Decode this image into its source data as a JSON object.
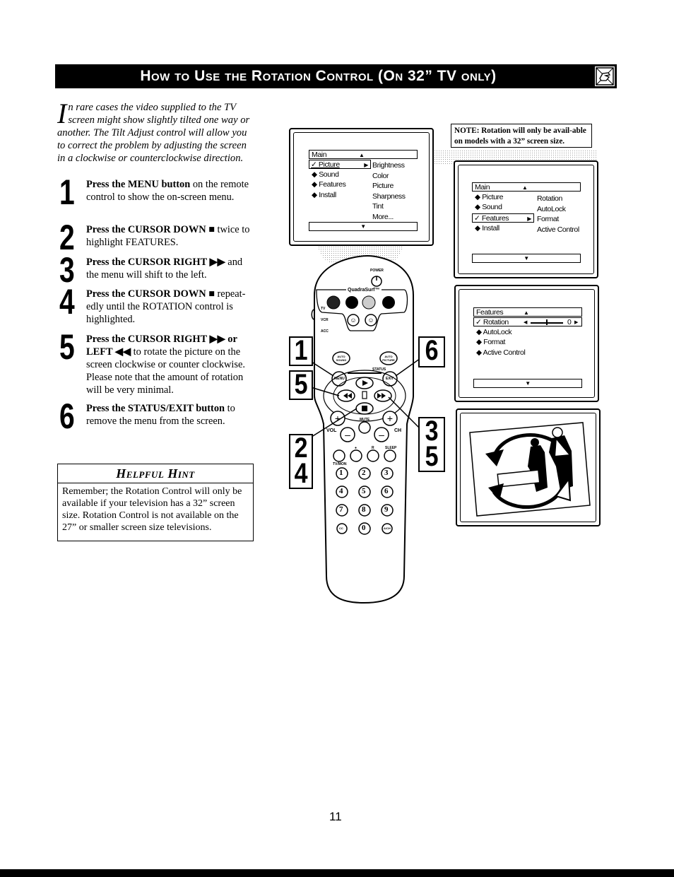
{
  "header": {
    "title": "How to Use the Rotation Control (On 32” TV only)",
    "icon": "remote-hand-icon"
  },
  "intro": {
    "dropcap": "I",
    "text": "n rare cases the video supplied to the TV screen might show slightly tilted one way or another. The Tilt Adjust control will allow you to correct the problem by adjusting the screen in a clockwise or counterclockwise direction."
  },
  "steps": [
    {
      "num": "1",
      "bold": "Press the MENU button",
      "rest": " on the remote control to show the on-screen menu."
    },
    {
      "num": "2",
      "bold": "Press the CURSOR DOWN ■",
      "rest": " twice to highlight FEATURES."
    },
    {
      "num": "3",
      "bold": "Press the CURSOR RIGHT ▶▶",
      "rest": " and the menu will shift to the left."
    },
    {
      "num": "4",
      "bold": "Press the CURSOR DOWN ■",
      "rest": " repeat-edly until the ROTATION control is highlighted."
    },
    {
      "num": "5",
      "bold": "Press the CURSOR RIGHT ▶▶ or LEFT ◀◀",
      "rest": " to rotate the picture on the screen clockwise or counter clockwise. Please note that the amount of rotation will be very minimal."
    },
    {
      "num": "6",
      "bold": "Press the STATUS/EXIT button",
      "rest": " to remove the menu from the screen."
    }
  ],
  "hint": {
    "title": "Helpful Hint",
    "body": "Remember; the Rotation Control will only be available if your television has a 32” screen size. Rotation Control is not available on the 27” or smaller screen size televisions."
  },
  "note": {
    "text": "NOTE: Rotation will only be avail-able on models with a 32” screen size."
  },
  "screen1": {
    "head": "Main",
    "up_arrow": "▲",
    "down_arrow": "▼",
    "left_items": [
      "✓ Picture",
      "◆ Sound",
      "◆ Features",
      "◆ Install"
    ],
    "selected_arrow": "▶",
    "right_items": [
      "Brightness",
      "Color",
      "Picture",
      "Sharpness",
      "Tint",
      "More..."
    ]
  },
  "screen2": {
    "head": "Main",
    "up_arrow": "▲",
    "down_arrow": "▼",
    "left_items": [
      "◆ Picture",
      "◆ Sound",
      "✓ Features",
      "◆ Install"
    ],
    "selected_arrow": "▶",
    "right_items": [
      "Rotation",
      "AutoLock",
      "Format",
      "Active Control"
    ]
  },
  "screen3": {
    "head": "Features",
    "up_arrow": "▲",
    "down_arrow": "▼",
    "selected": "✓ Rotation",
    "slider_value": "0",
    "slider_position": 0.5,
    "items": [
      "◆ AutoLock",
      "◆ Format",
      "◆ Active Control"
    ]
  },
  "remote": {
    "power": "POWER",
    "quadrasurf": "QuadraSurf™",
    "modes": [
      "TV",
      "VCR",
      "ACC"
    ],
    "auto_sound": "AUTO SOUND",
    "auto_picture": "AUTO PICTURE",
    "menu": "MENU",
    "status": "STATUS",
    "exit": "EXIT",
    "vol": "VOL",
    "ch": "CH",
    "mute": "MUTE",
    "row_labels": [
      "●",
      "R",
      "SLEEP"
    ],
    "tvmon": "TV/MON",
    "digits": [
      "1",
      "2",
      "3",
      "4",
      "5",
      "6",
      "7",
      "8",
      "9"
    ],
    "cc": "CC",
    "zero": "0",
    "ach": "A/CH"
  },
  "callouts": {
    "c1": "1",
    "c5a": "5",
    "c24": [
      "2",
      "4"
    ],
    "c6": "6",
    "c35": [
      "3",
      "5"
    ]
  },
  "page_number": "11"
}
